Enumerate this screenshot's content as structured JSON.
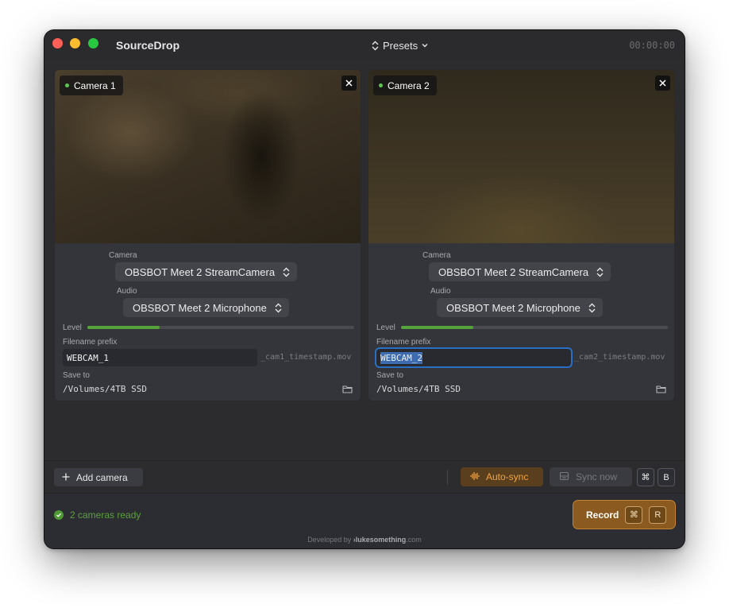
{
  "app": {
    "title": "SourceDrop",
    "presets_label": "Presets",
    "timer": "00:00:00"
  },
  "cameras": [
    {
      "name": "Camera 1",
      "camera_label": "Camera",
      "camera_value": "OBSBOT Meet 2 StreamCamera",
      "audio_label": "Audio",
      "audio_value": "OBSBOT Meet 2 Microphone",
      "level_label": "Level",
      "level": 0.27,
      "prefix_label": "Filename prefix",
      "prefix_value": "WEBCAM_1",
      "prefix_suffix": "_cam1_timestamp.mov",
      "save_label": "Save to",
      "save_path": "/Volumes/4TB SSD"
    },
    {
      "name": "Camera 2",
      "camera_label": "Camera",
      "camera_value": "OBSBOT Meet 2 StreamCamera",
      "audio_label": "Audio",
      "audio_value": "OBSBOT Meet 2 Microphone",
      "level_label": "Level",
      "level": 0.27,
      "prefix_label": "Filename prefix",
      "prefix_value": "WEBCAM_2",
      "prefix_suffix": "_cam2_timestamp.mov",
      "save_label": "Save to",
      "save_path": "/Volumes/4TB SSD"
    }
  ],
  "toolbar": {
    "add_camera_label": "Add camera",
    "autosync_label": "Auto-sync",
    "syncnow_label": "Sync now",
    "sync_shortcut": [
      "⌘",
      "B"
    ]
  },
  "status": {
    "text": "2 cameras ready",
    "record_label": "Record",
    "record_shortcut": [
      "⌘",
      "R"
    ]
  },
  "footer": {
    "prefix": "Developed by ",
    "brand": "›lukesomething",
    "domain": ".com"
  },
  "colors": {
    "accent": "#f2a23c",
    "record": "#8a5a20",
    "ready": "#59a13c",
    "focus": "#2a6fc4",
    "level": "#56a23b"
  },
  "icons": [
    "chevron-updown-icon",
    "chevron-down-icon",
    "close-icon",
    "folder-icon",
    "plus-icon",
    "waveform-icon",
    "sync-drive-icon",
    "check-icon"
  ]
}
